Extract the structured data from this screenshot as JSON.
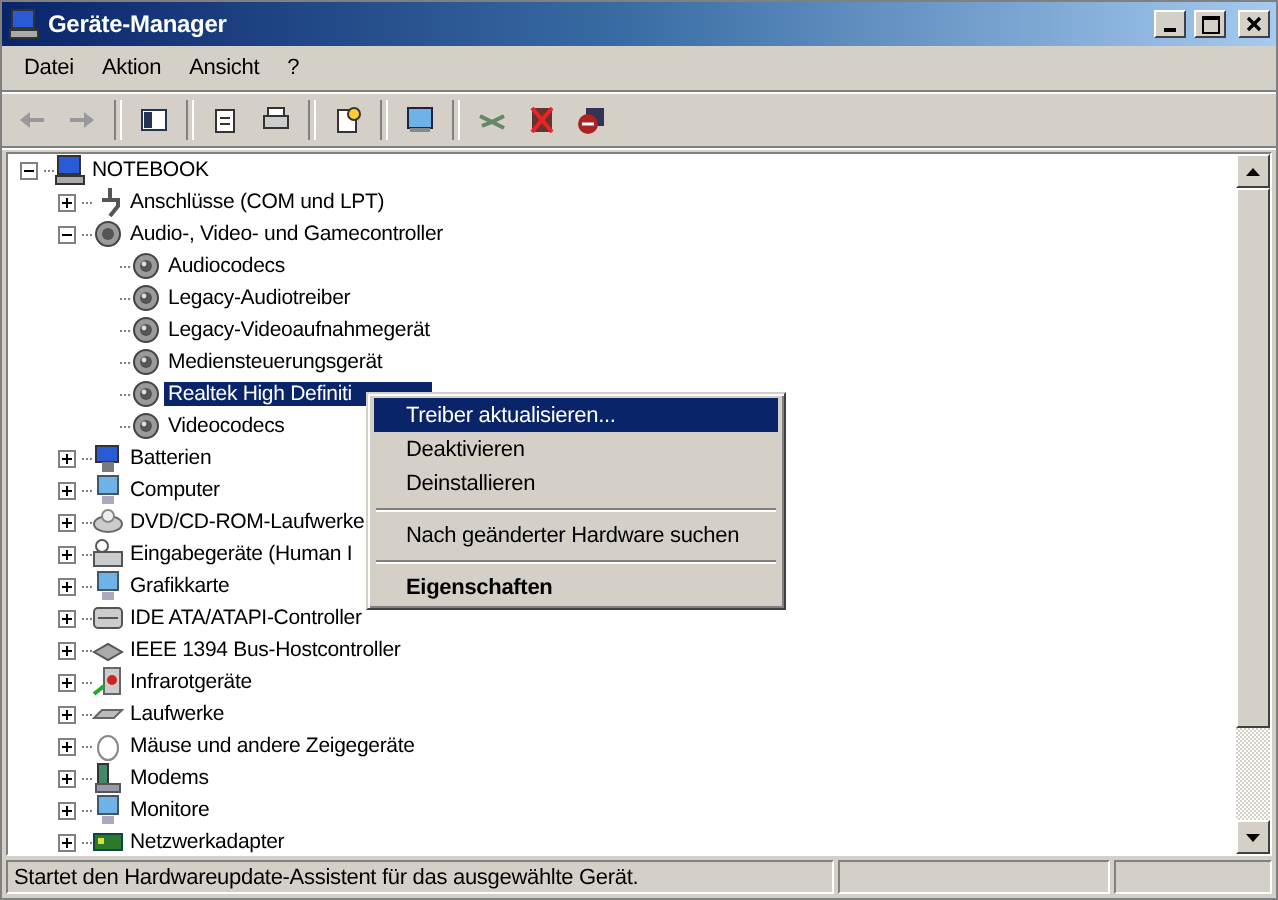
{
  "window": {
    "title": "Geräte-Manager"
  },
  "menu_bar": [
    "Datei",
    "Aktion",
    "Ansicht",
    "?"
  ],
  "tree": {
    "label": "NOTEBOOK",
    "expanded": true,
    "children": [
      {
        "label": "Anschlüsse (COM und LPT)",
        "expanded": false,
        "selected": false
      },
      {
        "label": "Audio-, Video- und Gamecontroller",
        "expanded": true,
        "selected": false,
        "children": [
          {
            "label": "Audiocodecs",
            "selected": false
          },
          {
            "label": "Legacy-Audiotreiber",
            "selected": false
          },
          {
            "label": "Legacy-Videoaufnahmegerät",
            "selected": false
          },
          {
            "label": "Mediensteuerungsgerät",
            "selected": false
          },
          {
            "label": "Realtek High Definiti",
            "selected": true
          },
          {
            "label": "Videocodecs",
            "selected": false
          }
        ]
      },
      {
        "label": "Batterien",
        "expanded": false,
        "selected": false
      },
      {
        "label": "Computer",
        "expanded": false,
        "selected": false
      },
      {
        "label": "DVD/CD-ROM-Laufwerke",
        "expanded": false,
        "selected": false
      },
      {
        "label": "Eingabegeräte (Human I",
        "expanded": false,
        "selected": false
      },
      {
        "label": "Grafikkarte",
        "expanded": false,
        "selected": false
      },
      {
        "label": "IDE ATA/ATAPI-Controller",
        "expanded": false,
        "selected": false
      },
      {
        "label": "IEEE 1394 Bus-Hostcontroller",
        "expanded": false,
        "selected": false
      },
      {
        "label": "Infrarotgeräte",
        "expanded": false,
        "selected": false
      },
      {
        "label": "Laufwerke",
        "expanded": false,
        "selected": false
      },
      {
        "label": "Mäuse und andere Zeigegeräte",
        "expanded": false,
        "selected": false
      },
      {
        "label": "Modems",
        "expanded": false,
        "selected": false
      },
      {
        "label": "Monitore",
        "expanded": false,
        "selected": false
      },
      {
        "label": "Netzwerkadapter",
        "expanded": false,
        "selected": false
      }
    ]
  },
  "context_menu": [
    {
      "kind": "item",
      "label": "Treiber aktualisieren...",
      "selected": true
    },
    {
      "kind": "item",
      "label": "Deaktivieren",
      "selected": false
    },
    {
      "kind": "item",
      "label": "Deinstallieren",
      "selected": false
    },
    {
      "kind": "separator"
    },
    {
      "kind": "item",
      "label": "Nach geänderter Hardware suchen",
      "selected": false
    },
    {
      "kind": "separator"
    },
    {
      "kind": "default",
      "label": "Eigenschaften",
      "selected": false
    }
  ],
  "status_bar": {
    "text": "Startet den Hardwareupdate-Assistent für das ausgewählte Gerät."
  }
}
